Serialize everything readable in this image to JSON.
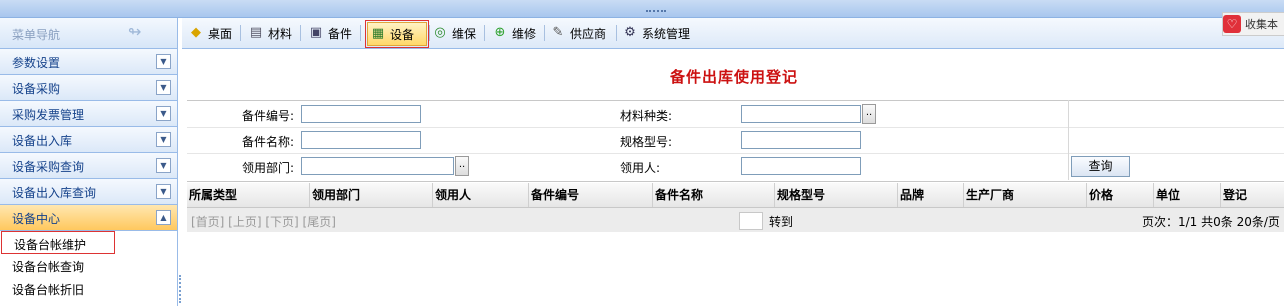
{
  "sidebar": {
    "title": "菜单导航",
    "groups": [
      {
        "label": "参数设置"
      },
      {
        "label": "设备采购"
      },
      {
        "label": "采购发票管理"
      },
      {
        "label": "设备出入库"
      },
      {
        "label": "设备采购查询"
      },
      {
        "label": "设备出入库查询"
      },
      {
        "label": "设备中心"
      }
    ],
    "items": [
      {
        "label": "设备台帐维护"
      },
      {
        "label": "设备台帐查询"
      },
      {
        "label": "设备台帐折旧"
      }
    ]
  },
  "toolbar": {
    "buttons": [
      {
        "label": "桌面",
        "icon": "desktop-icon"
      },
      {
        "label": "材料",
        "icon": "material-icon"
      },
      {
        "label": "备件",
        "icon": "spare-parts-icon"
      },
      {
        "label": "设备",
        "icon": "equipment-icon"
      },
      {
        "label": "维保",
        "icon": "maintenance-icon"
      },
      {
        "label": "维修",
        "icon": "repair-icon"
      },
      {
        "label": "供应商",
        "icon": "supplier-icon"
      },
      {
        "label": "系统管理",
        "icon": "system-icon"
      }
    ],
    "active": "设备"
  },
  "favorite": {
    "label": "收集本"
  },
  "page": {
    "title": "备件出库使用登记"
  },
  "form": {
    "part_no_label": "备件编号:",
    "part_name_label": "备件名称:",
    "dept_label": "领用部门:",
    "material_type_label": "材料种类:",
    "spec_label": "规格型号:",
    "receiver_label": "领用人:",
    "browse": "..",
    "query_button": "查询"
  },
  "grid": {
    "columns": [
      "所属类型",
      "领用部门",
      "领用人",
      "备件编号",
      "备件名称",
      "规格型号",
      "品牌",
      "生产厂商",
      "价格",
      "单位",
      "登记"
    ]
  },
  "pager": {
    "nav": "[首页] [上页] [下页] [尾页]",
    "goto": "转到",
    "info": "页次：1/1  共0条 20条/页"
  },
  "colors": {
    "accent": "#cc1111",
    "nav_border": "#99bbe8",
    "active_bg": "#ffc85e"
  }
}
